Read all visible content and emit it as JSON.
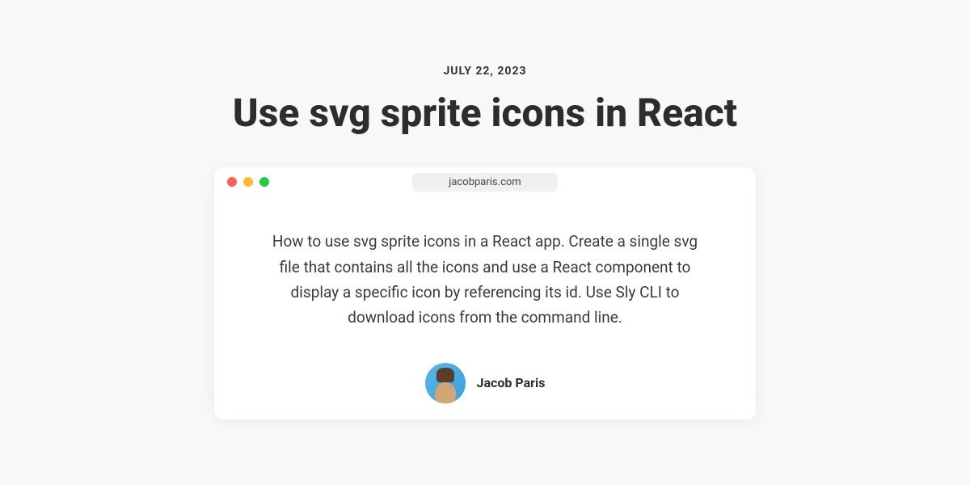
{
  "header": {
    "date": "JULY 22, 2023",
    "title": "Use svg sprite icons in React"
  },
  "browser": {
    "url": "jacobparis.com"
  },
  "content": {
    "description": "How to use svg sprite icons in a React app. Create a single svg file that contains all the icons and use a React component to display a specific icon by referencing its id. Use Sly CLI to download icons from the command line."
  },
  "author": {
    "name": "Jacob Paris"
  }
}
